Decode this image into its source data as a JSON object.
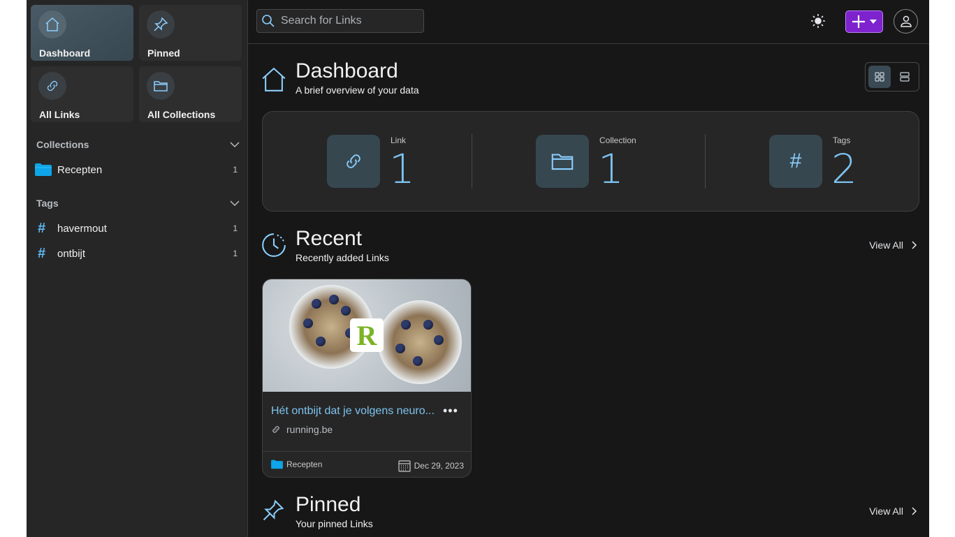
{
  "sidebar": {
    "tiles": [
      {
        "label": "Dashboard",
        "icon": "home-icon",
        "active": true
      },
      {
        "label": "Pinned",
        "icon": "pin-icon",
        "active": false
      },
      {
        "label": "All Links",
        "icon": "link-icon",
        "active": false
      },
      {
        "label": "All Collections",
        "icon": "folder-icon",
        "active": false
      }
    ],
    "collections": {
      "title": "Collections",
      "items": [
        {
          "name": "Recepten",
          "count": "1",
          "color": "#0ea5e9"
        }
      ]
    },
    "tags": {
      "title": "Tags",
      "items": [
        {
          "name": "havermout",
          "count": "1"
        },
        {
          "name": "ontbijt",
          "count": "1"
        }
      ]
    }
  },
  "topbar": {
    "search_placeholder": "Search for Links",
    "add_button_color": "#7e22ce"
  },
  "dashboard": {
    "title": "Dashboard",
    "subtitle": "A brief overview of your data",
    "view_modes": [
      "grid",
      "list"
    ],
    "active_view": "grid"
  },
  "stats": [
    {
      "label": "Link",
      "value": "1",
      "icon": "link-icon"
    },
    {
      "label": "Collection",
      "value": "1",
      "icon": "folder-icon"
    },
    {
      "label": "Tags",
      "value": "2",
      "icon": "hash-icon",
      "glyph": "#"
    }
  ],
  "recent": {
    "title": "Recent",
    "subtitle": "Recently added Links",
    "view_all": "View All",
    "links": [
      {
        "title": "Hét ontbijt dat je volgens neuro...",
        "url": "running.be",
        "logo_letter": "R",
        "collection": "Recepten",
        "date": "Dec 29, 2023",
        "menu": "•••"
      }
    ]
  },
  "pinned": {
    "title": "Pinned",
    "subtitle": "Your pinned Links",
    "view_all": "View All"
  },
  "colors": {
    "accent": "#7cc3ef",
    "background": "#171717",
    "panel": "#262626"
  }
}
